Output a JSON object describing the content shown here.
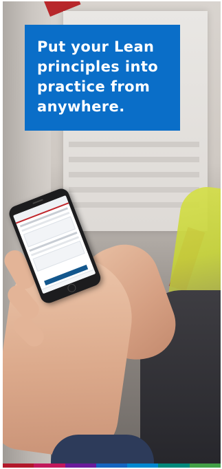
{
  "headline": {
    "text": "Put your Lean principles into practice from anywhere."
  },
  "phone": {
    "app_screen_icon": "lean-app-screen-icon"
  },
  "brand_stripe": {
    "colors": [
      "#b2182b",
      "#c2185b",
      "#6a1b9a",
      "#1565c0",
      "#0288d1",
      "#00897b",
      "#43a047"
    ]
  }
}
